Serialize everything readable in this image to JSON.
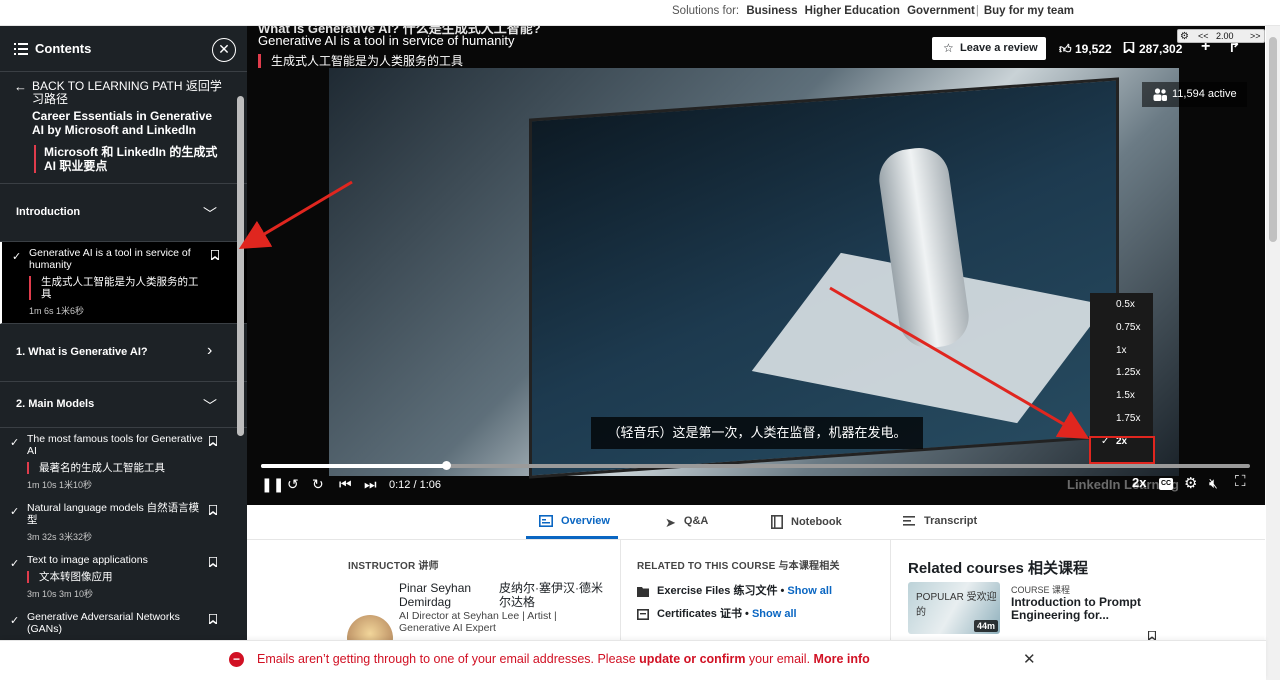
{
  "topbar": {
    "solutions_label": "Solutions for:",
    "links": [
      "Business",
      "Higher Education",
      "Government",
      "Buy for my team"
    ]
  },
  "sidebar": {
    "header_title": "Contents",
    "back_label": "BACK TO LEARNING PATH 返回学习路径",
    "path_title": "Career Essentials in Generative AI by Microsoft and LinkedIn",
    "path_title_zh": "Microsoft 和 LinkedIn 的生成式 AI 职业要点",
    "sections": [
      {
        "title": "Introduction",
        "expanded": true,
        "items": [
          {
            "title": "Generative AI is a tool in service of humanity",
            "zh": "生成式人工智能是为人类服务的工具",
            "duration": "1m 6s  1米6秒",
            "active": true
          }
        ]
      },
      {
        "title": "1. What is Generative AI?",
        "expanded": false,
        "items": []
      },
      {
        "title": "2. Main Models",
        "expanded": true,
        "items": [
          {
            "title": "The most famous tools for Generative AI",
            "zh": "最著名的生成人工智能工具",
            "duration": "1m 10s  1米10秒"
          },
          {
            "title": "Natural language models 自然语言模型",
            "zh": "",
            "duration": "3m 32s  3米32秒"
          },
          {
            "title": "Text to image applications",
            "zh": "文本转图像应用",
            "duration": "3m 10s  3m 10秒"
          },
          {
            "title": "Generative Adversarial Networks (GANs)",
            "zh": "",
            "duration": ""
          }
        ]
      }
    ]
  },
  "video": {
    "title_en_top": "What is Generative AI? 什么是生成式人工智能?",
    "title_en": "Generative AI is a tool in service of humanity",
    "title_zh": "生成式人工智能是为人类服务的工具",
    "review_label": "Leave a review",
    "likes": "19,522",
    "saves": "287,302",
    "active_label": "11,594 active",
    "speed_mini": {
      "left": "<<",
      "value": "2.00",
      "right": ">>"
    },
    "subtitle": "（轻音乐）这是第一次，人类在监督，机器在发电。",
    "speed_options": [
      "0.5x",
      "0.75x",
      "1x",
      "1.25x",
      "1.5x",
      "1.75x",
      "2x"
    ],
    "speed_selected": "2x",
    "timecode": "0:12 / 1:06",
    "progress": 0.187,
    "watermark": "LinkedIn Learning",
    "speed_indicator": "2x",
    "cc_label": "CC"
  },
  "tabs": [
    {
      "label": "Overview",
      "active": true
    },
    {
      "label": "Q&A",
      "active": false
    },
    {
      "label": "Notebook",
      "active": false
    },
    {
      "label": "Transcript",
      "active": false
    }
  ],
  "instructor": {
    "label": "INSTRUCTOR 讲师",
    "name": "Pinar Seyhan Demirdag",
    "name_zh": "皮纳尔·塞伊汉·德米尔达格",
    "bio": "AI Director at Seyhan Lee | Artist | Generative AI Expert"
  },
  "related_course": {
    "label": "RELATED TO THIS COURSE 与本课程相关",
    "rows": [
      {
        "label": "Exercise Files 练习文件",
        "link": "Show all"
      },
      {
        "label": "Certificates 证书",
        "link": "Show all"
      }
    ]
  },
  "related_courses": {
    "heading": "Related courses 相关课程",
    "course_badge": "POPULAR 受欢迎的",
    "course_duration": "44m",
    "course_type": "COURSE 课程",
    "course_title": "Introduction to Prompt Engineering for..."
  },
  "alert": {
    "prefix": "Emails aren’t getting through to one of your email addresses. Please ",
    "link1": "update or confirm",
    "middle": " your email. ",
    "link2": "More info"
  },
  "colors": {
    "accent": "#0a66c2",
    "error": "#d11124",
    "annotation": "#e0261f",
    "zh_bar": "#e03c4c"
  }
}
